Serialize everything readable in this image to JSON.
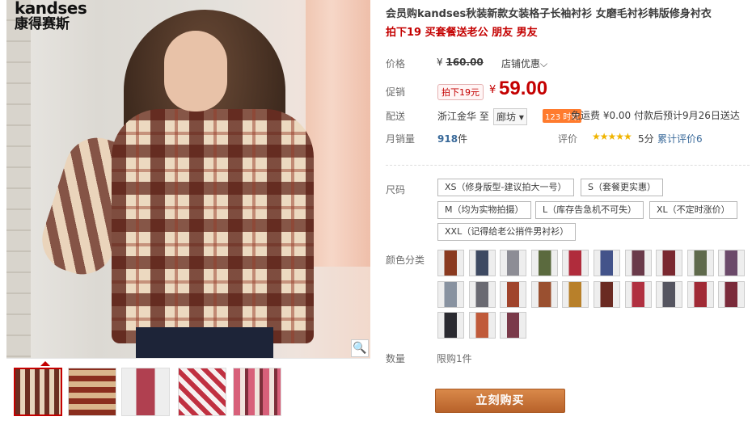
{
  "brand": {
    "logo_en": "kandses",
    "logo_cn": "康得赛斯"
  },
  "gallery": {
    "zoom_icon": "🔍",
    "thumbs": [
      "thumb-1",
      "thumb-2",
      "thumb-3",
      "thumb-4",
      "thumb-5"
    ]
  },
  "product": {
    "title": "会员购kandses秋装新款女装格子长袖衬衫 女磨毛衬衫韩版修身衬衣",
    "promo": "拍下19 买套餐送老公 朋友 男友"
  },
  "price": {
    "label": "价格",
    "currency": "¥",
    "original": "160.00",
    "shop_promo": "店铺优惠",
    "chevron": "⌵"
  },
  "promotion": {
    "label": "促销",
    "tag": "拍下19元",
    "currency": "¥",
    "price": "59.00"
  },
  "shipping": {
    "label": "配送",
    "origin": "浙江金华",
    "to": "至",
    "destination": "廊坊",
    "dest_arrow": "▾",
    "badge": "123 时效",
    "freight": "免运费 ¥0.00 付款后预计9月26日送达"
  },
  "sales": {
    "label": "月销量",
    "count": "918",
    "unit": "件",
    "rating_label": "评价",
    "stars": "★★★★★",
    "score": "5分",
    "reviews": "累计评价6"
  },
  "sizes": {
    "label": "尺码",
    "options": [
      "XS（修身版型-建议拍大一号）",
      "S（套餐更实惠）",
      "M（均为实物拍摄）",
      "L（库存告急机不可失）",
      "XL（不定时涨价）",
      "XXL（记得给老公捎件男衬衫）"
    ]
  },
  "colors": {
    "label": "颜色分类",
    "swatches": [
      "#8a3a20",
      "#3e4a62",
      "#8d8d95",
      "#5b6a3e",
      "#b02c3c",
      "#43538a",
      "#6a3a4a",
      "#7a2830",
      "#5f6a4c",
      "#6b4a6a",
      "#8892a0",
      "#6a6a72",
      "#a0442c",
      "#9a5030",
      "#b8802a",
      "#6a2a22",
      "#b03040",
      "#555560",
      "#a02a35",
      "#7a2a3a",
      "#2a2a30",
      "#c05a3a",
      "#7a3a4a"
    ]
  },
  "quantity": {
    "label": "数量",
    "limit": "限购1件"
  },
  "buy_button": "立刻购买",
  "colors_theme": {
    "accent": "#c40000",
    "buy": "#c8742a",
    "link": "#3a6a9a"
  }
}
